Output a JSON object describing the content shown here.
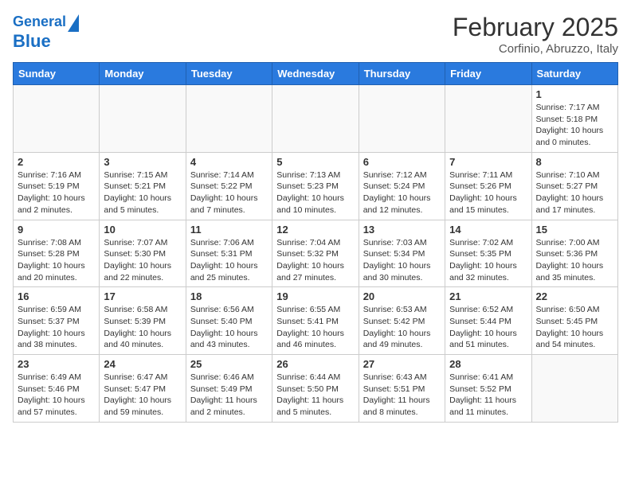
{
  "header": {
    "logo_line1": "General",
    "logo_line2": "Blue",
    "month": "February 2025",
    "location": "Corfinio, Abruzzo, Italy"
  },
  "weekdays": [
    "Sunday",
    "Monday",
    "Tuesday",
    "Wednesday",
    "Thursday",
    "Friday",
    "Saturday"
  ],
  "weeks": [
    [
      {
        "day": "",
        "info": ""
      },
      {
        "day": "",
        "info": ""
      },
      {
        "day": "",
        "info": ""
      },
      {
        "day": "",
        "info": ""
      },
      {
        "day": "",
        "info": ""
      },
      {
        "day": "",
        "info": ""
      },
      {
        "day": "1",
        "info": "Sunrise: 7:17 AM\nSunset: 5:18 PM\nDaylight: 10 hours\nand 0 minutes."
      }
    ],
    [
      {
        "day": "2",
        "info": "Sunrise: 7:16 AM\nSunset: 5:19 PM\nDaylight: 10 hours\nand 2 minutes."
      },
      {
        "day": "3",
        "info": "Sunrise: 7:15 AM\nSunset: 5:21 PM\nDaylight: 10 hours\nand 5 minutes."
      },
      {
        "day": "4",
        "info": "Sunrise: 7:14 AM\nSunset: 5:22 PM\nDaylight: 10 hours\nand 7 minutes."
      },
      {
        "day": "5",
        "info": "Sunrise: 7:13 AM\nSunset: 5:23 PM\nDaylight: 10 hours\nand 10 minutes."
      },
      {
        "day": "6",
        "info": "Sunrise: 7:12 AM\nSunset: 5:24 PM\nDaylight: 10 hours\nand 12 minutes."
      },
      {
        "day": "7",
        "info": "Sunrise: 7:11 AM\nSunset: 5:26 PM\nDaylight: 10 hours\nand 15 minutes."
      },
      {
        "day": "8",
        "info": "Sunrise: 7:10 AM\nSunset: 5:27 PM\nDaylight: 10 hours\nand 17 minutes."
      }
    ],
    [
      {
        "day": "9",
        "info": "Sunrise: 7:08 AM\nSunset: 5:28 PM\nDaylight: 10 hours\nand 20 minutes."
      },
      {
        "day": "10",
        "info": "Sunrise: 7:07 AM\nSunset: 5:30 PM\nDaylight: 10 hours\nand 22 minutes."
      },
      {
        "day": "11",
        "info": "Sunrise: 7:06 AM\nSunset: 5:31 PM\nDaylight: 10 hours\nand 25 minutes."
      },
      {
        "day": "12",
        "info": "Sunrise: 7:04 AM\nSunset: 5:32 PM\nDaylight: 10 hours\nand 27 minutes."
      },
      {
        "day": "13",
        "info": "Sunrise: 7:03 AM\nSunset: 5:34 PM\nDaylight: 10 hours\nand 30 minutes."
      },
      {
        "day": "14",
        "info": "Sunrise: 7:02 AM\nSunset: 5:35 PM\nDaylight: 10 hours\nand 32 minutes."
      },
      {
        "day": "15",
        "info": "Sunrise: 7:00 AM\nSunset: 5:36 PM\nDaylight: 10 hours\nand 35 minutes."
      }
    ],
    [
      {
        "day": "16",
        "info": "Sunrise: 6:59 AM\nSunset: 5:37 PM\nDaylight: 10 hours\nand 38 minutes."
      },
      {
        "day": "17",
        "info": "Sunrise: 6:58 AM\nSunset: 5:39 PM\nDaylight: 10 hours\nand 40 minutes."
      },
      {
        "day": "18",
        "info": "Sunrise: 6:56 AM\nSunset: 5:40 PM\nDaylight: 10 hours\nand 43 minutes."
      },
      {
        "day": "19",
        "info": "Sunrise: 6:55 AM\nSunset: 5:41 PM\nDaylight: 10 hours\nand 46 minutes."
      },
      {
        "day": "20",
        "info": "Sunrise: 6:53 AM\nSunset: 5:42 PM\nDaylight: 10 hours\nand 49 minutes."
      },
      {
        "day": "21",
        "info": "Sunrise: 6:52 AM\nSunset: 5:44 PM\nDaylight: 10 hours\nand 51 minutes."
      },
      {
        "day": "22",
        "info": "Sunrise: 6:50 AM\nSunset: 5:45 PM\nDaylight: 10 hours\nand 54 minutes."
      }
    ],
    [
      {
        "day": "23",
        "info": "Sunrise: 6:49 AM\nSunset: 5:46 PM\nDaylight: 10 hours\nand 57 minutes."
      },
      {
        "day": "24",
        "info": "Sunrise: 6:47 AM\nSunset: 5:47 PM\nDaylight: 10 hours\nand 59 minutes."
      },
      {
        "day": "25",
        "info": "Sunrise: 6:46 AM\nSunset: 5:49 PM\nDaylight: 11 hours\nand 2 minutes."
      },
      {
        "day": "26",
        "info": "Sunrise: 6:44 AM\nSunset: 5:50 PM\nDaylight: 11 hours\nand 5 minutes."
      },
      {
        "day": "27",
        "info": "Sunrise: 6:43 AM\nSunset: 5:51 PM\nDaylight: 11 hours\nand 8 minutes."
      },
      {
        "day": "28",
        "info": "Sunrise: 6:41 AM\nSunset: 5:52 PM\nDaylight: 11 hours\nand 11 minutes."
      },
      {
        "day": "",
        "info": ""
      }
    ]
  ]
}
